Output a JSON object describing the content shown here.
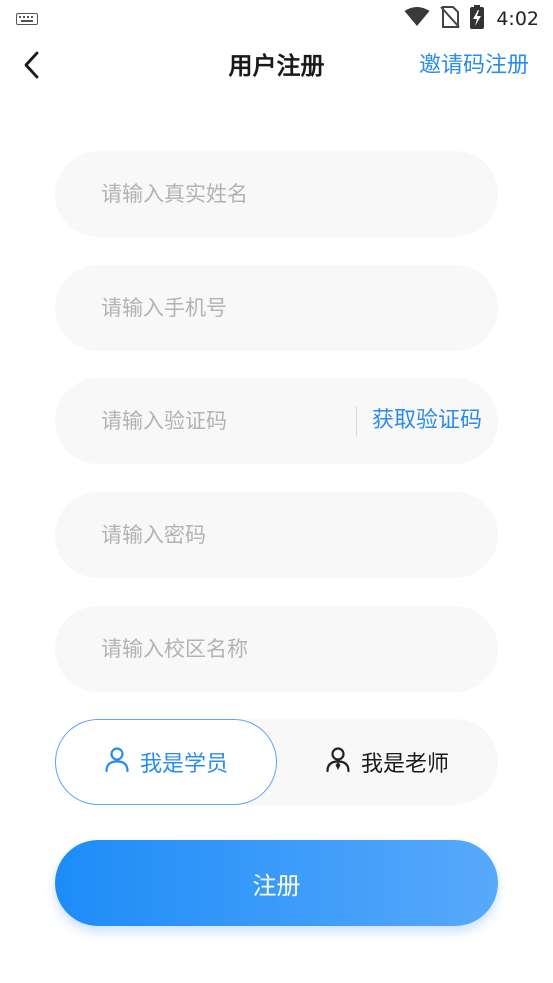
{
  "status_bar": {
    "time": "4:02"
  },
  "nav": {
    "title": "用户注册",
    "invite_register": "邀请码注册"
  },
  "form": {
    "name_placeholder": "请输入真实姓名",
    "phone_placeholder": "请输入手机号",
    "code_placeholder": "请输入验证码",
    "get_code_label": "获取验证码",
    "password_placeholder": "请输入密码",
    "campus_placeholder": "请输入校区名称"
  },
  "roles": {
    "student_label": "我是学员",
    "teacher_label": "我是老师",
    "selected": "student"
  },
  "submit_label": "注册",
  "colors": {
    "accent": "#2b8cf0",
    "field_bg": "#f8f8f8",
    "button_gradient_start": "#1d8cf8",
    "button_gradient_end": "#58a9fb"
  }
}
